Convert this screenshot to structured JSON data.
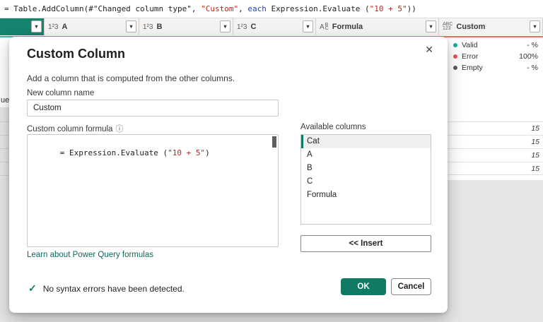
{
  "icons": {
    "dropdown_arrow": "▾",
    "close": "✕",
    "info": "ⓘ",
    "check": "✓",
    "whole_number_type": "1²3",
    "text_type": {
      "main": "A",
      "top": "B",
      "bottom": "C"
    },
    "any_type": {
      "top": "ABC",
      "bottom": "123"
    }
  },
  "colors": {
    "accent_teal": "#15836d",
    "underline_teal": "#3fb3a2",
    "underline_error": "#f16b5c",
    "ok_button": "#0f7b65",
    "valid_dot": "#1aa99c",
    "error_dot": "#e8564c",
    "empty_dot": "#5a5a5a"
  },
  "formula_bar": {
    "prefix": "= Table.AddColumn(#\"Changed column type\", ",
    "string1": "\"Custom\"",
    "mid1": ", ",
    "keyword": "each",
    "mid2": " Expression.Evaluate (",
    "string2": "\"10 + 5\"",
    "suffix": "))"
  },
  "table": {
    "columns": [
      {
        "label": "",
        "selected": true
      },
      {
        "label": "A"
      },
      {
        "label": "B"
      },
      {
        "label": "C"
      },
      {
        "label": "Formula"
      },
      {
        "label": "Custom"
      }
    ],
    "quality_card": {
      "rows": [
        {
          "label": "Valid",
          "value": "- %"
        },
        {
          "label": "Error",
          "value": "100%"
        },
        {
          "label": "Empty",
          "value": "- %"
        }
      ]
    },
    "custom_values": [
      "15",
      "15",
      "15",
      "15"
    ],
    "left_row_fragment": "ue"
  },
  "dialog": {
    "title": "Custom Column",
    "subtitle": "Add a column that is computed from the other columns.",
    "name_label": "New column name",
    "name_value": "Custom",
    "formula_label": "Custom column formula",
    "formula_prefix": "= Expression.Evaluate (",
    "formula_string": "\"10 + 5\"",
    "formula_suffix": ")",
    "available_label": "Available columns",
    "available_columns": [
      "Cat",
      "A",
      "B",
      "C",
      "Formula"
    ],
    "insert_label": "<< Insert",
    "link_label": "Learn about Power Query formulas",
    "status_text": "No syntax errors have been detected.",
    "ok_label": "OK",
    "cancel_label": "Cancel"
  }
}
